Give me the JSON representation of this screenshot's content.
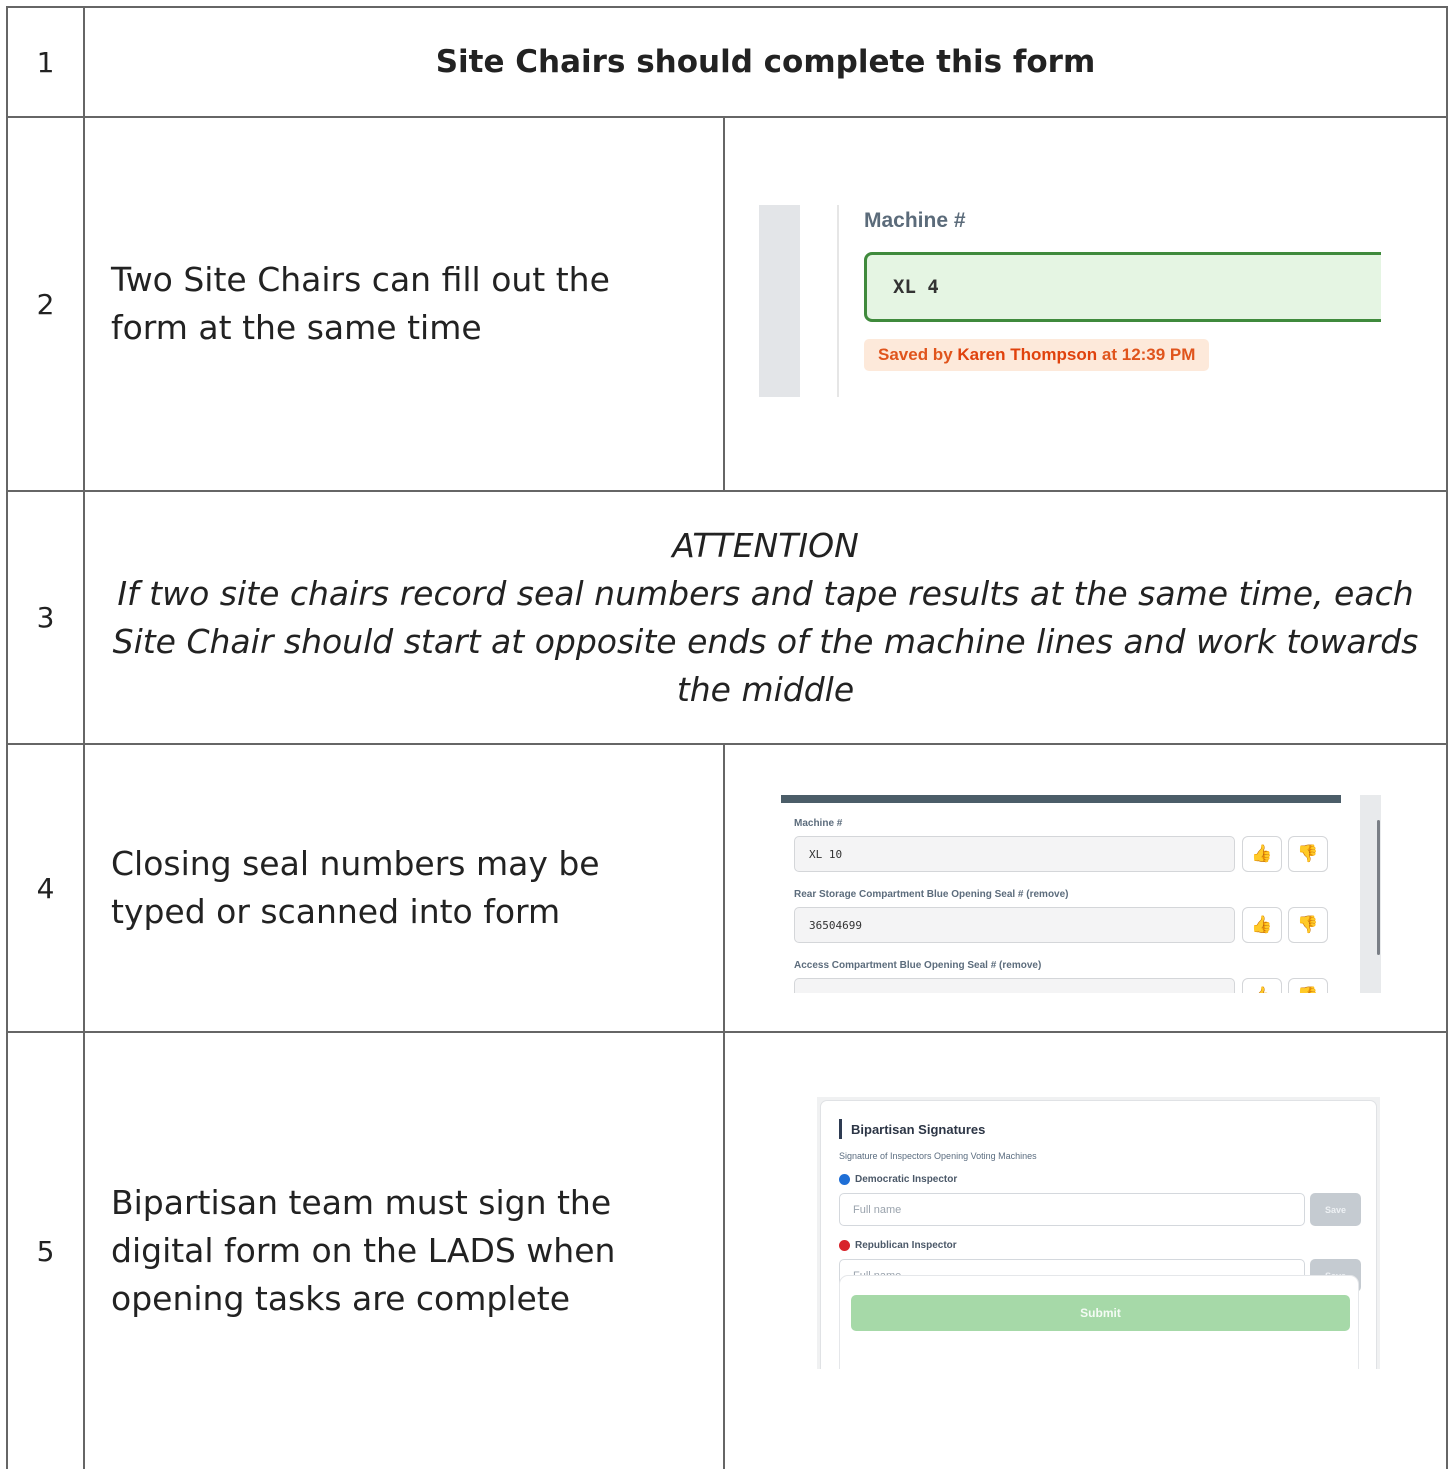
{
  "rows": [
    {
      "num": "1",
      "text": "Site Chairs should complete this form"
    },
    {
      "num": "2",
      "text": "Two Site Chairs can fill out the form at the same time"
    },
    {
      "num": "3",
      "heading": "ATTENTION",
      "text": "If two site chairs record seal numbers and tape results at the same time, each Site Chair should start at opposite ends of the machine lines and work towards the middle"
    },
    {
      "num": "4",
      "text": "Closing seal numbers may be typed or scanned into form"
    },
    {
      "num": "5",
      "text": "Bipartisan team must sign the digital form on the LADS when opening tasks are complete"
    }
  ],
  "shot1": {
    "label": "Machine #",
    "value": "XL  4",
    "saved_prefix": "Saved by ",
    "saved_name": "Karen Thompson",
    "saved_suffix": " at 12:39 PM"
  },
  "shot2": {
    "fields": [
      {
        "label": "Machine #",
        "value": "XL 10"
      },
      {
        "label": "Rear Storage Compartment Blue Opening Seal # (remove)",
        "value": "36504699"
      },
      {
        "label": "Access Compartment Blue Opening Seal # (remove)",
        "value": ""
      }
    ],
    "thumbs_up_icon": "👍",
    "thumbs_down_icon": "👎"
  },
  "shot3": {
    "title": "Bipartisan Signatures",
    "subtitle": "Signature of Inspectors Opening Voting Machines",
    "democratic_label": "Democratic Inspector",
    "republican_label": "Republican Inspector",
    "placeholder": "Full name",
    "save_label": "Save",
    "submit_label": "Submit",
    "colors": {
      "democratic": "#1f6fd6",
      "republican": "#d8232a"
    }
  }
}
